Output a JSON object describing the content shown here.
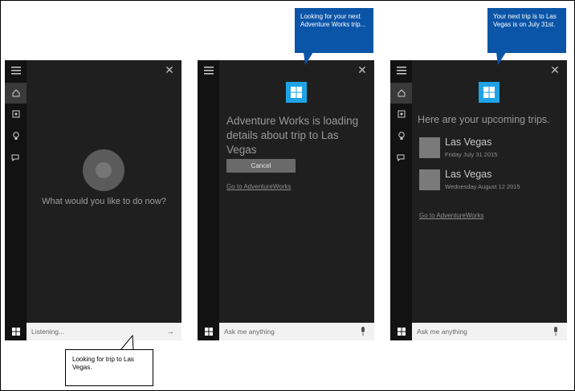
{
  "panel1": {
    "question": "What would you like to do now?",
    "input_text": "Listening...",
    "icons": [
      "hamburger-icon",
      "home-icon",
      "notebook-icon",
      "lightbulb-icon",
      "feedback-icon",
      "close-icon",
      "windows-icon",
      "arrow-right-icon"
    ]
  },
  "panel2": {
    "loading_text": "Adventure Works is loading details about trip to Las Vegas",
    "cancel_label": "Cancel",
    "link_label": "Go to AdventureWorks",
    "input_placeholder": "Ask me anything"
  },
  "panel3": {
    "title": "Here are your upcoming trips.",
    "trips": [
      {
        "name": "Las Vegas",
        "date": "Friday July 31 2015"
      },
      {
        "name": "Las Vegas",
        "date": "Wednesday August 12 2015"
      }
    ],
    "link_label": "Go to AdventureWorks",
    "input_placeholder": "Ask me anything"
  },
  "callouts": {
    "top_middle": "Looking for your next Adventure Works trip...",
    "top_right": "Your next trip is to Las Vegas is on July 31st.",
    "bottom_left": "Looking for trip to Las Vegas."
  },
  "colors": {
    "panel_bg": "#1f1f1f",
    "rail_bg": "#121212",
    "accent_tile": "#1fa3e6",
    "callout_blue": "#0b55a8"
  }
}
